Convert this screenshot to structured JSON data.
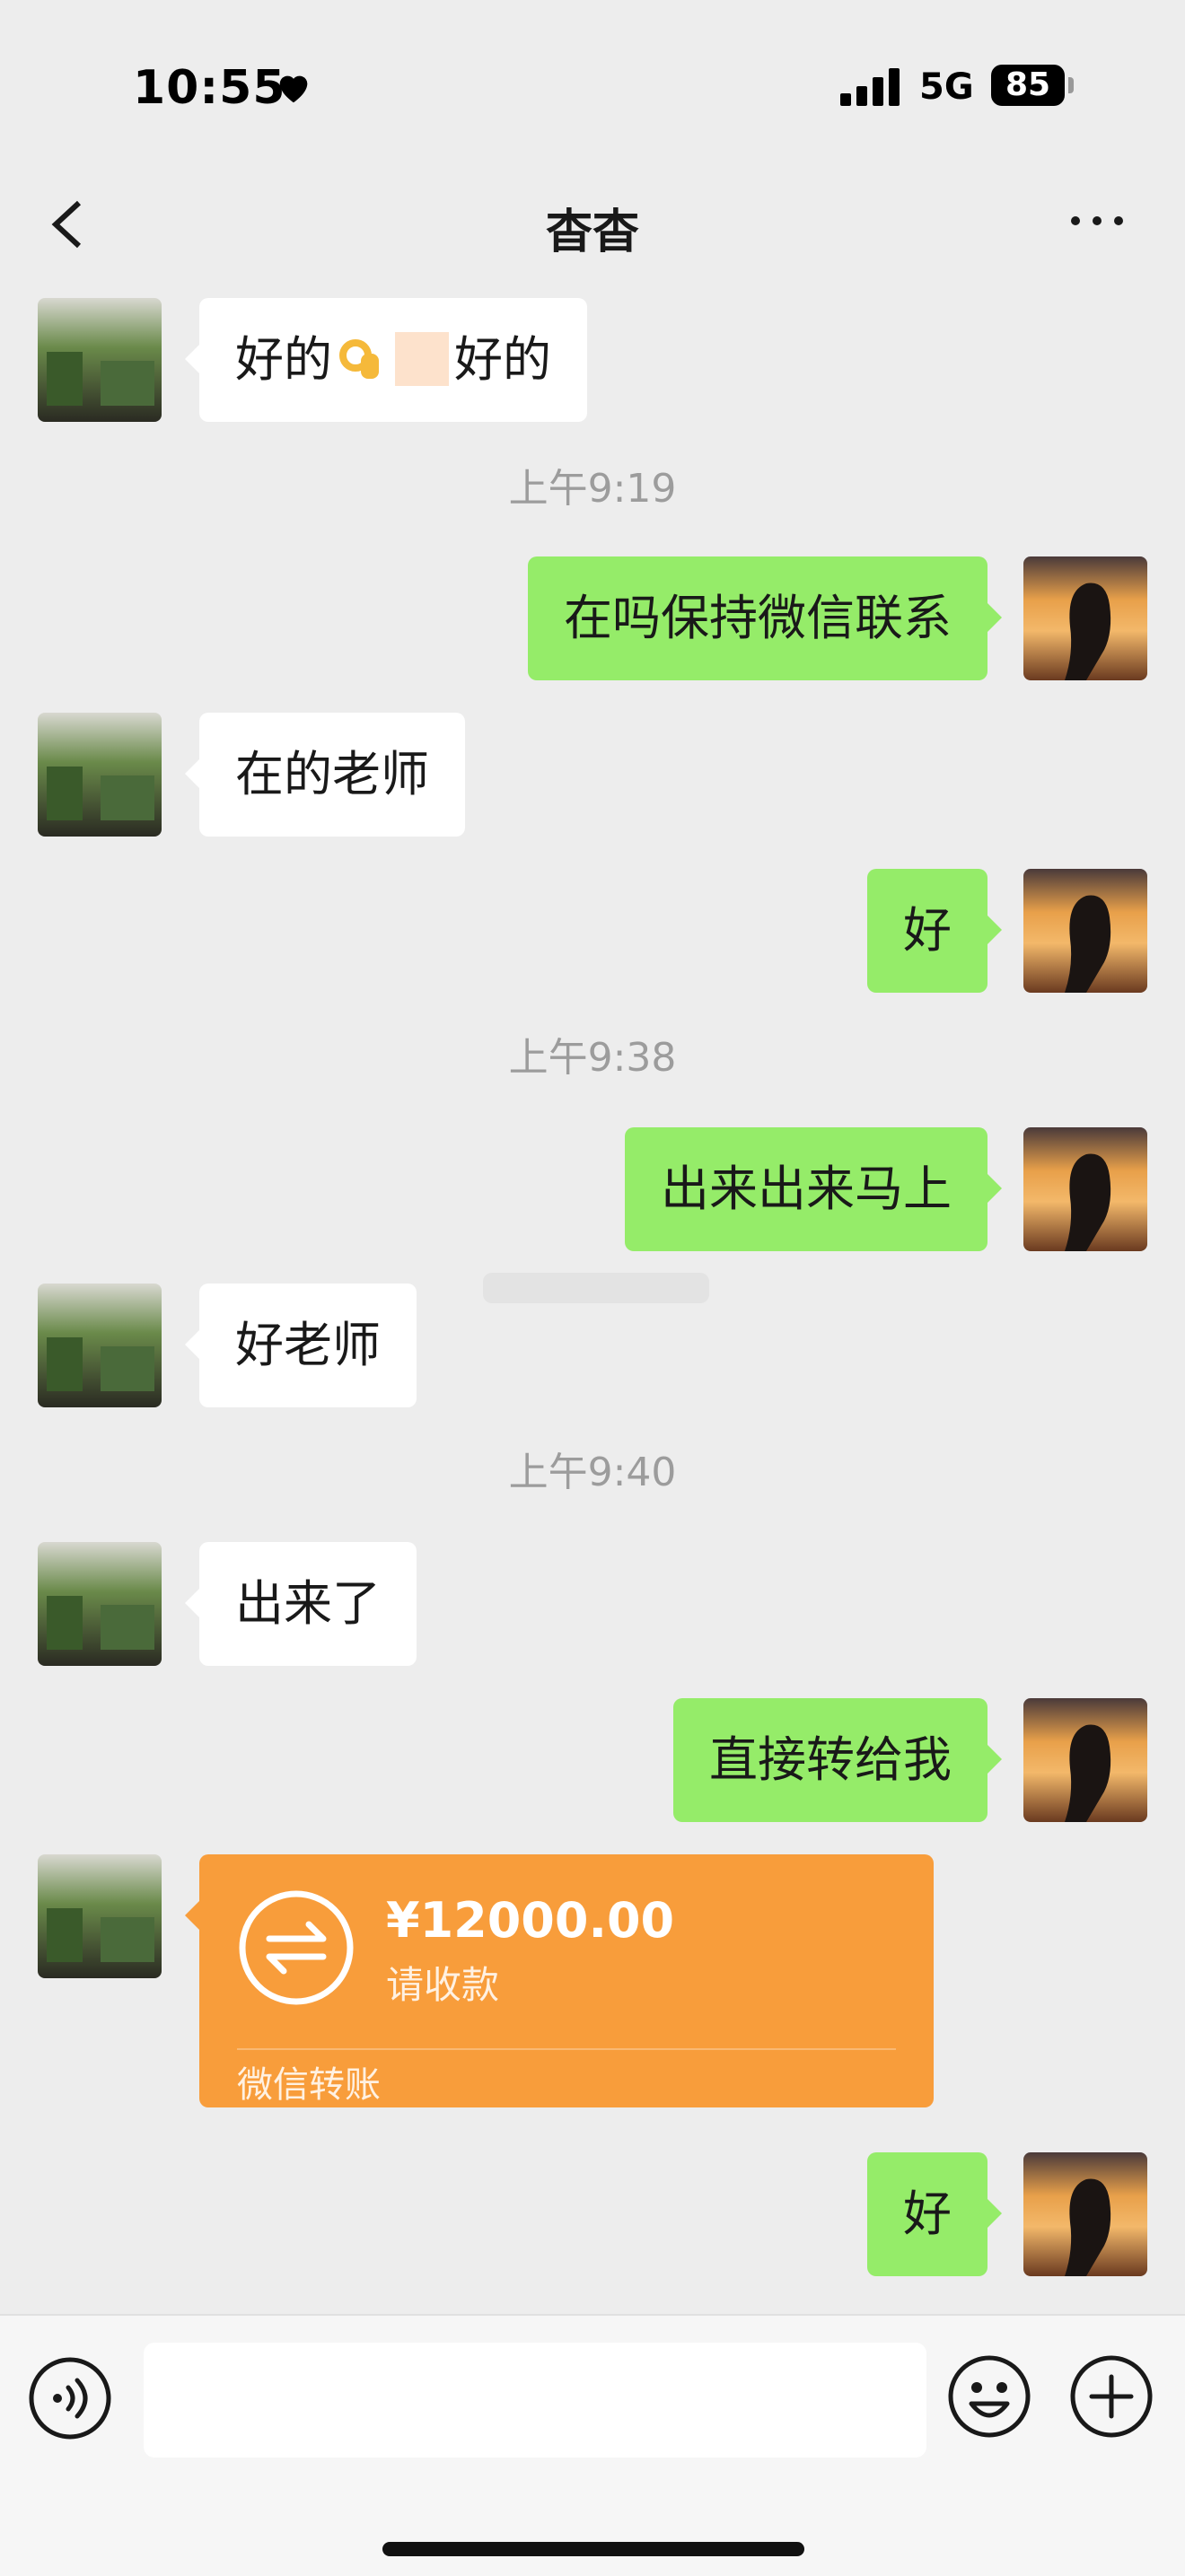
{
  "status": {
    "time": "10:55",
    "network": "5G",
    "battery": "85"
  },
  "nav": {
    "title": "杳杳"
  },
  "messages": [
    {
      "side": "in",
      "text_a": "好的",
      "text_b": "好的"
    },
    {
      "timestamp": "上午9:19"
    },
    {
      "side": "out",
      "text": "在吗保持微信联系"
    },
    {
      "side": "in",
      "text": "在的老师"
    },
    {
      "side": "out",
      "text": "好"
    },
    {
      "timestamp": "上午9:38"
    },
    {
      "side": "out",
      "text": "出来出来马上"
    },
    {
      "side": "in",
      "text": "好老师"
    },
    {
      "timestamp": "上午9:40"
    },
    {
      "side": "in",
      "text": "出来了"
    },
    {
      "side": "out",
      "text": "直接转给我"
    },
    {
      "side": "in",
      "type": "transfer",
      "amount": "¥12000.00",
      "subtitle": "请收款",
      "footer": "微信转账"
    },
    {
      "side": "out",
      "text": "好"
    }
  ],
  "input": {
    "placeholder": ""
  },
  "icons": {
    "back": "chevron-left-icon",
    "more": "more-dots-icon",
    "voice": "voice-icon",
    "emoji": "emoji-icon",
    "plus": "plus-icon",
    "transfer": "transfer-arrows-icon",
    "heart": "heart-icon",
    "signal": "signal-icon",
    "ok_hand": "ok-hand-emoji"
  },
  "colors": {
    "background": "#ededed",
    "outgoing": "#95ec69",
    "incoming": "#ffffff",
    "transfer": "#f89d3b"
  }
}
